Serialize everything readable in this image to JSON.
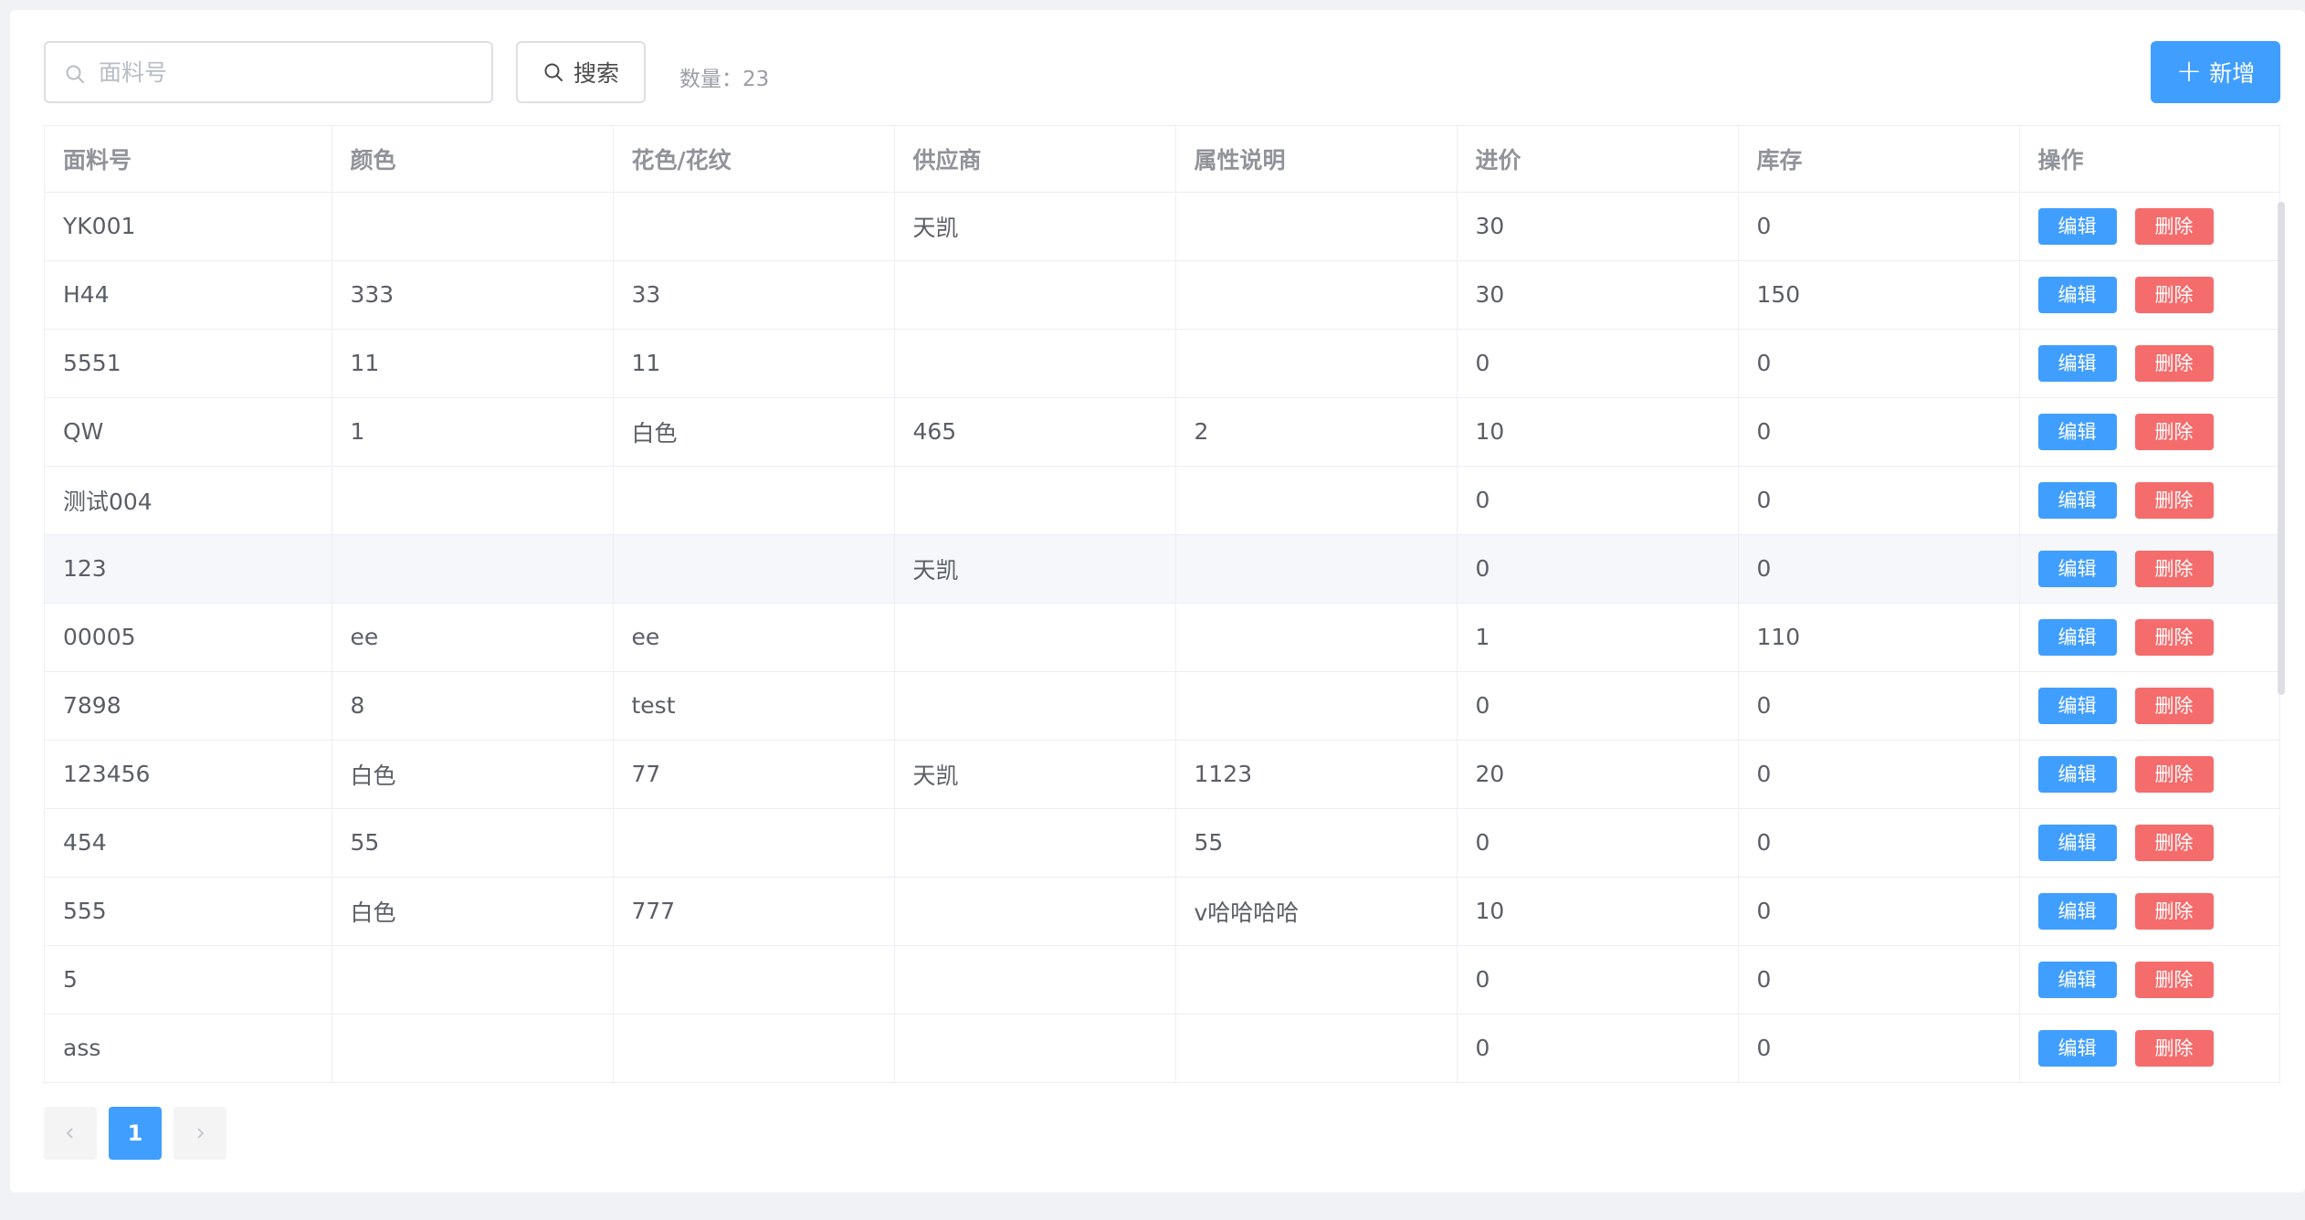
{
  "toolbar": {
    "search_placeholder": "面料号",
    "search_label": "搜索",
    "count_text": "数量：23",
    "add_label": "新增"
  },
  "table": {
    "columns": [
      "面料号",
      "颜色",
      "花色/花纹",
      "供应商",
      "属性说明",
      "进价",
      "库存",
      "操作"
    ],
    "edit_label": "编辑",
    "delete_label": "删除",
    "rows": [
      [
        "YK001",
        "",
        "",
        "天凯",
        "",
        "30",
        "0"
      ],
      [
        "H44",
        "333",
        "33",
        "",
        "",
        "30",
        "150"
      ],
      [
        "5551",
        "11",
        "11",
        "",
        "",
        "0",
        "0"
      ],
      [
        "QW",
        "1",
        "白色",
        "465",
        "2",
        "10",
        "0"
      ],
      [
        "测试004",
        "",
        "",
        "",
        "",
        "0",
        "0"
      ],
      [
        "123",
        "",
        "",
        "天凯",
        "",
        "0",
        "0"
      ],
      [
        "00005",
        "ee",
        "ee",
        "",
        "",
        "1",
        "110"
      ],
      [
        "7898",
        "8",
        "test",
        "",
        "",
        "0",
        "0"
      ],
      [
        "123456",
        "白色",
        "77",
        "天凯",
        "1123",
        "20",
        "0"
      ],
      [
        "454",
        "55",
        "",
        "",
        "55",
        "0",
        "0"
      ],
      [
        "555",
        "白色",
        "777",
        "",
        "v哈哈哈哈",
        "10",
        "0"
      ],
      [
        "5",
        "",
        "",
        "",
        "",
        "0",
        "0"
      ],
      [
        "ass",
        "",
        "",
        "",
        "",
        "0",
        "0"
      ]
    ],
    "hovered_row": 5
  },
  "pagination": {
    "prev_icon": "chevron-left-icon",
    "current_page": "1",
    "next_icon": "chevron-right-icon"
  },
  "colors": {
    "primary": "#409eff",
    "danger": "#f56c6c",
    "background": "#f0f2f5"
  }
}
